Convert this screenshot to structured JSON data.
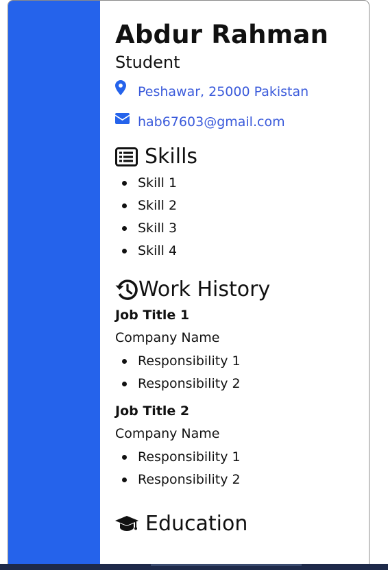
{
  "resume": {
    "name": "Abdur Rahman",
    "role": "Student",
    "contact": {
      "location": "Peshawar, 25000 Pakistan",
      "email": "hab67603@gmail.com"
    },
    "skills": {
      "title": "Skills",
      "items": [
        "Skill 1",
        "Skill 2",
        "Skill 3",
        "Skill 4"
      ]
    },
    "work_history": {
      "title": "Work History",
      "jobs": [
        {
          "title": "Job Title 1",
          "company": "Company Name",
          "responsibilities": [
            "Responsibility 1",
            "Responsibility 2"
          ]
        },
        {
          "title": "Job Title 2",
          "company": "Company Name",
          "responsibilities": [
            "Responsibility 1",
            "Responsibility 2"
          ]
        }
      ]
    },
    "education": {
      "title": "Education"
    }
  },
  "colors": {
    "sidebar": "#2563eb",
    "link": "#3b5bdb",
    "text": "#111111"
  },
  "icons": [
    "location-pin-icon",
    "envelope-icon",
    "list-icon",
    "history-icon",
    "graduation-cap-icon"
  ]
}
